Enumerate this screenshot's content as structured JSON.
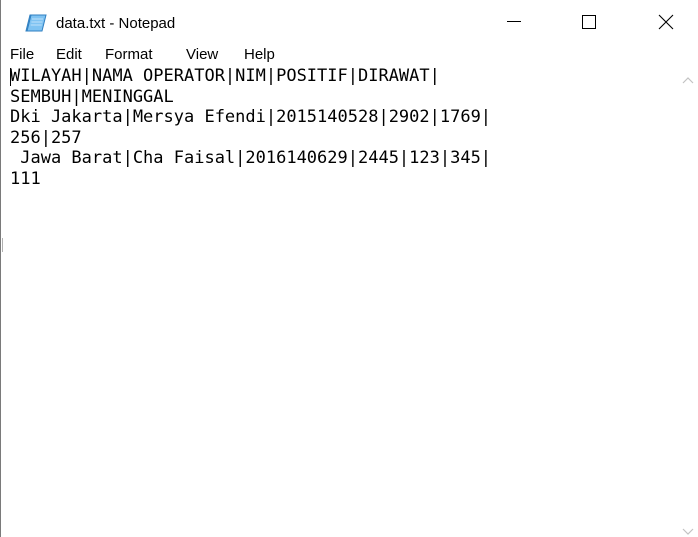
{
  "window": {
    "title": "data.txt - Notepad",
    "icon": "notepad-icon"
  },
  "menu": {
    "file": "File",
    "edit": "Edit",
    "format": "Format",
    "view": "View",
    "help": "Help"
  },
  "editor": {
    "lines": [
      "WILAYAH|NAMA OPERATOR|NIM|POSITIF|DIRAWAT|",
      "SEMBUH|MENINGGAL",
      "Dki Jakarta|Mersya Efendi|2015140528|2902|1769|",
      "256|257",
      " Jawa Barat|Cha Faisal|2016140629|2445|123|345|",
      "111"
    ]
  },
  "colors": {
    "background": "#ffffff",
    "text": "#000000",
    "icon_blue": "#5aa5e0"
  }
}
